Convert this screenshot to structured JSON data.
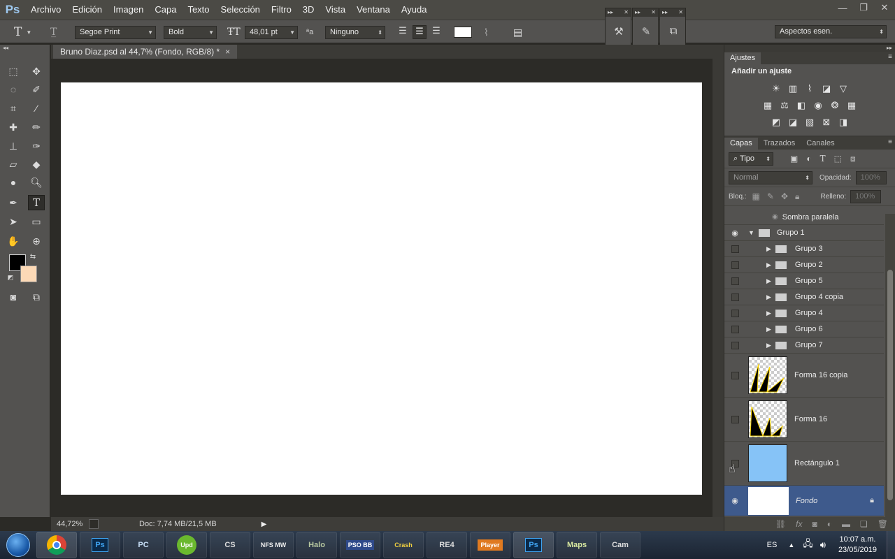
{
  "app": {
    "logo": "Ps"
  },
  "menu": [
    "Archivo",
    "Edición",
    "Imagen",
    "Capa",
    "Texto",
    "Selección",
    "Filtro",
    "3D",
    "Vista",
    "Ventana",
    "Ayuda"
  ],
  "window_controls": {
    "minimize": "—",
    "restore": "❐",
    "close": "✕"
  },
  "options": {
    "tool_glyph": "T",
    "font_family": "Segoe Print",
    "font_style": "Bold",
    "font_size": "48,01 pt",
    "antialias": "Ninguno",
    "text_color": "#ffffff",
    "workspace": "Aspectos esen."
  },
  "document": {
    "tab_title": "Bruno Diaz.psd al 44,7% (Fondo, RGB/8) *",
    "close": "×",
    "zoom": "44,72%",
    "doc_info": "Doc: 7,74 MB/21,5 MB"
  },
  "colors": {
    "foreground": "#000000",
    "background": "#fcd9b6"
  },
  "adjustments": {
    "tab": "Ajustes",
    "title": "Añadir un ajuste"
  },
  "layers_panel": {
    "tabs": [
      "Capas",
      "Trazados",
      "Canales"
    ],
    "filter_kind": "Tipo",
    "blend_mode": "Normal",
    "opacity_label": "Opacidad:",
    "opacity_value": "100%",
    "lock_label": "Bloq.:",
    "fill_label": "Relleno:",
    "fill_value": "100%",
    "effect_row": "Sombra paralela",
    "group_root": "Grupo 1",
    "subgroups": [
      "Grupo 3",
      "Grupo 2",
      "Grupo 5",
      "Grupo 4 copia",
      "Grupo 4",
      "Grupo 6",
      "Grupo 7"
    ],
    "big_layers": [
      "Forma 16 copia",
      "Forma 16",
      "Rectángulo 1"
    ],
    "background_layer": "Fondo"
  },
  "taskbar": {
    "apps": [
      "Chrome",
      "Ps",
      "PC",
      "Upd",
      "CS",
      "NFS MW",
      "Halo",
      "PSO BB",
      "Crash",
      "RE4",
      "Player",
      "Ps",
      "Maps",
      "Cam"
    ],
    "language": "ES",
    "time": "10:07 a.m.",
    "date": "23/05/2019"
  }
}
